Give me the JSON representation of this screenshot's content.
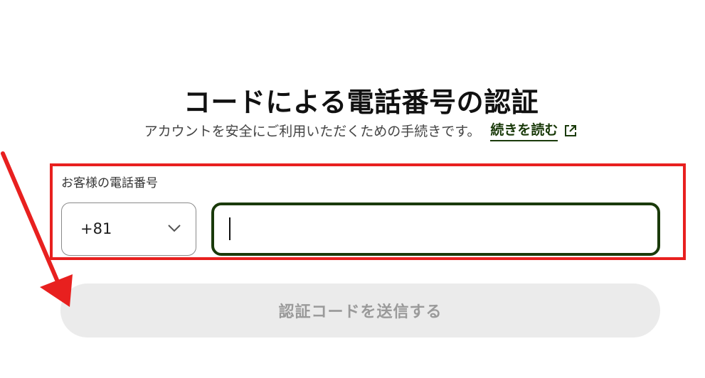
{
  "page": {
    "title": "コードによる電話番号の認証",
    "description": "アカウントを安全にご利用いただくための手続きです。",
    "read_more_label": "続きを読む",
    "read_more_icon": "external-link-icon"
  },
  "form": {
    "phone_label": "お客様の電話番号",
    "country_code": "+81",
    "country_chevron_icon": "chevron-down-icon",
    "phone_value": "",
    "submit_label": "認証コードを送信する",
    "submit_disabled": true
  },
  "annotation": {
    "box_color": "#e8201f",
    "arrow_color": "#e8201f",
    "pointer_icon": "red-arrow-icon"
  },
  "colors": {
    "accent": "#1a3a0a",
    "button_disabled_bg": "#ebebeb",
    "button_disabled_text": "#9a9a9a"
  }
}
